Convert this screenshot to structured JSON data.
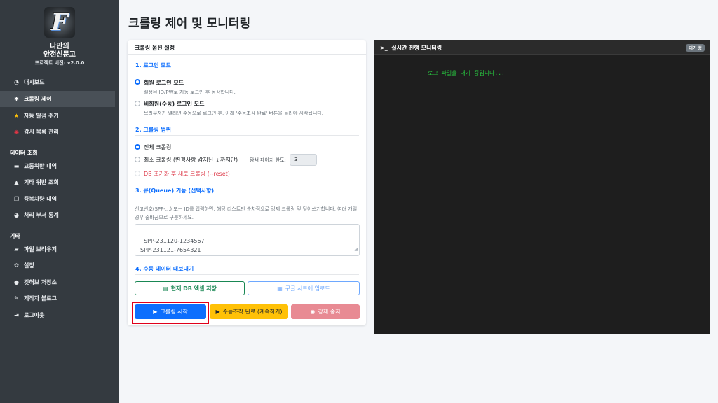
{
  "sidebar": {
    "logo_letter": "F",
    "brand_line1": "나만의",
    "brand_line2": "안전신문고",
    "version": "프로젝트 버전: v2.0.0",
    "items": [
      {
        "label": "대시보드",
        "icon": "dashboard-icon"
      },
      {
        "label": "크롤링 제어",
        "icon": "spider-icon"
      },
      {
        "label": "자동 발점 주기",
        "icon": "star-icon"
      },
      {
        "label": "감시 목록 관리",
        "icon": "eye-icon"
      }
    ],
    "section_data": "데이터 조회",
    "data_items": [
      {
        "label": "교통위반 내역",
        "icon": "car-icon"
      },
      {
        "label": "기타 위반 조회",
        "icon": "warning-icon"
      },
      {
        "label": "중복차량 내역",
        "icon": "copy-icon"
      },
      {
        "label": "처리 부서 통계",
        "icon": "chart-icon"
      }
    ],
    "section_etc": "기타",
    "etc_items": [
      {
        "label": "파일 브라우저",
        "icon": "folder-icon"
      },
      {
        "label": "설정",
        "icon": "gear-icon"
      },
      {
        "label": "깃허브 저장소",
        "icon": "github-icon"
      },
      {
        "label": "제작자 블로그",
        "icon": "pen-icon"
      },
      {
        "label": "로그아웃",
        "icon": "logout-icon"
      }
    ]
  },
  "main": {
    "title": "크롤링 제어 및 모니터링"
  },
  "options": {
    "header": "크롤링 옵션 설정",
    "login": {
      "section": "1. 로그인 모드",
      "member_label": "회원 로그인 모드",
      "member_help": "설정된 ID/PW로 자동 로그인 후 동작합니다.",
      "guest_label": "비회원(수동) 로그인 모드",
      "guest_help": "브라우저가 열리면 수동으로 로그인 후, 아래 '수동조작 완료' 버튼을 눌러야 시작됩니다."
    },
    "range": {
      "section": "2. 크롤링 범위",
      "full_label": "전체 크롤링",
      "min_label": "최소 크롤링 (변경사항 감지된 곳까지만)",
      "page_limit_label": "탐색 페이지 한도:",
      "page_limit_value": "3",
      "reset_label": "DB 초기화 후 새로 크롤링 (--reset)"
    },
    "queue": {
      "section": "3. 큐(Queue) 기능 (선택사항)",
      "description": "신고번호(SPP-...) 또는 ID를 입력하면, 해당 리스트만 순차적으로 강제 크롤링 및 덮어쓰기합니다. 여러 개일 경우 줄바꿈으로 구분하세요.",
      "value": "SPP-231120-1234567\nSPP-231121-7654321"
    },
    "export": {
      "section": "4. 수동 데이터 내보내기",
      "excel_label": "현재 DB 엑셀 저장",
      "sheets_label": "구글 시트에 업로드"
    },
    "actions": {
      "start_label": "크롤링 시작",
      "manual_done_label": "수동조작 완료 (계속하기)",
      "force_stop_label": "강제 중지"
    }
  },
  "monitor": {
    "title": "실시간 진행 모니터링",
    "status_badge": "대기 중",
    "log_line": "로그 파일을 대기 중입니다..."
  },
  "colors": {
    "sidebar_bg": "#343a40",
    "primary": "#0d6efd",
    "success": "#198754",
    "warning": "#ffc107",
    "danger": "#dc3545",
    "console_bg": "#1e1e1e",
    "console_text": "#28c840"
  }
}
